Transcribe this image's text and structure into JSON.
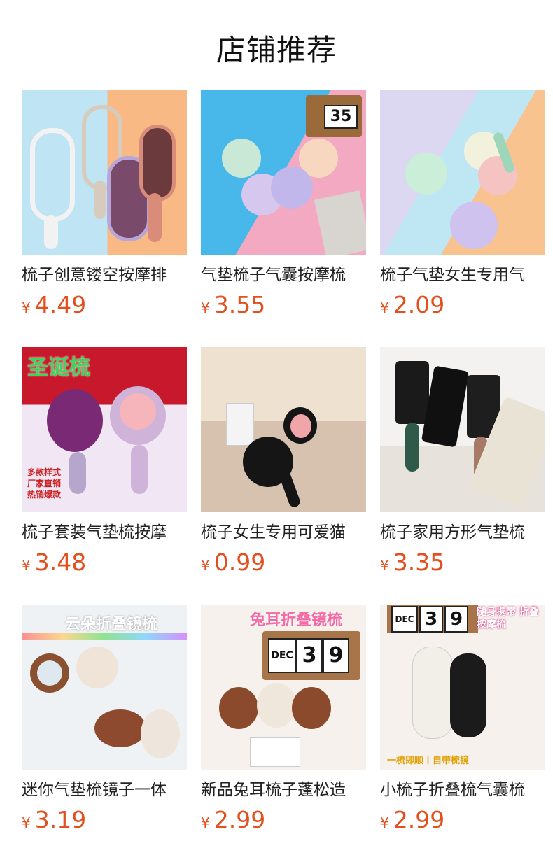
{
  "page_title": "店铺推荐",
  "currency": "¥",
  "colors": {
    "price": "#e1501e",
    "title": "#111111"
  },
  "products": [
    {
      "name": "梳子创意镂空按摩排",
      "price": "4.49",
      "image": "bg-split"
    },
    {
      "name": "气垫梳子气囊按摩梳",
      "price": "3.55",
      "image": "bg-blue-pink"
    },
    {
      "name": "梳子气垫女生专用气",
      "price": "2.09",
      "image": "bg-lav-peach"
    },
    {
      "name": "梳子套装气垫梳按摩",
      "price": "3.48",
      "image": "bg-xmas"
    },
    {
      "name": "梳子女生专用可爱猫",
      "price": "0.99",
      "image": "bg-beige"
    },
    {
      "name": "梳子家用方形气垫梳",
      "price": "3.35",
      "image": "bg-white"
    },
    {
      "name": "迷你气垫梳镜子一体",
      "price": "3.19",
      "image": "bg-rainbow"
    },
    {
      "name": "新品兔耳梳子蓬松造",
      "price": "2.99",
      "image": "bg-cream"
    },
    {
      "name": "小梳子折叠梳气囊梳",
      "price": "2.99",
      "image": "bg-cream"
    }
  ],
  "image_text": {
    "p4_banner": "圣诞梳",
    "p4_tags": [
      "多款样式",
      "厂家直销",
      "热销爆款"
    ],
    "p7_banner": "云朵折叠镜梳",
    "p8_banner": "兔耳折叠镜梳",
    "p8_digits": [
      "DEC",
      "3",
      "9"
    ],
    "p9_banner": "随身携带 折叠按摩梳",
    "p9_bottom": "一梳即顺丨自带梳镜",
    "p9_digits": [
      "DEC",
      "3",
      "9"
    ],
    "p2_digits": [
      "35"
    ]
  }
}
